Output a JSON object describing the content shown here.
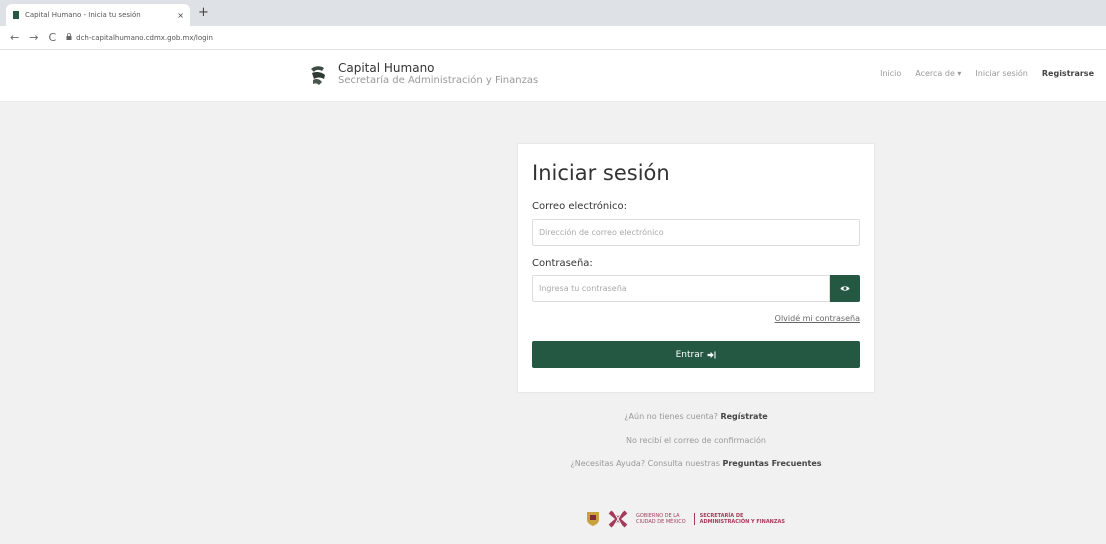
{
  "browser": {
    "tab_title": "Capital Humano - Inicia tu sesión",
    "tab_close": "×",
    "new_tab": "+",
    "back": "←",
    "forward": "→",
    "reload": "C",
    "url": "dch-capitalhumano.cdmx.gob.mx/login"
  },
  "header": {
    "brand_name": "Capital Humano",
    "brand_subtitle": "Secretaría de Administración y Finanzas",
    "nav": {
      "inicio": "Inicio",
      "acerca": "Acerca de ▾",
      "iniciar": "Iniciar sesión",
      "registrarse": "Registrarse"
    }
  },
  "login": {
    "title": "Iniciar sesión",
    "email_label": "Correo electrónico:",
    "email_placeholder": "Dirección de correo electrónico",
    "password_label": "Contraseña:",
    "password_placeholder": "Ingresa tu contraseña",
    "forgot": "Olvidé mi contraseña",
    "submit": "Entrar"
  },
  "links": {
    "no_account": "¿Aún no tienes cuenta?",
    "register": "Regístrate",
    "no_confirmation": "No recibí el correo de confirmación",
    "help_prefix": "¿Necesitas Ayuda? Consulta nuestras",
    "faq": "Preguntas Frecuentes"
  },
  "footer": {
    "gov_text_1": "GOBIERNO DE LA",
    "gov_text_2": "CIUDAD DE MÉXICO",
    "sec_text_1": "SECRETARÍA DE",
    "sec_text_2": "ADMINISTRACIÓN Y FINANZAS"
  },
  "colors": {
    "primary": "#245842",
    "accent": "#a53b5b"
  }
}
